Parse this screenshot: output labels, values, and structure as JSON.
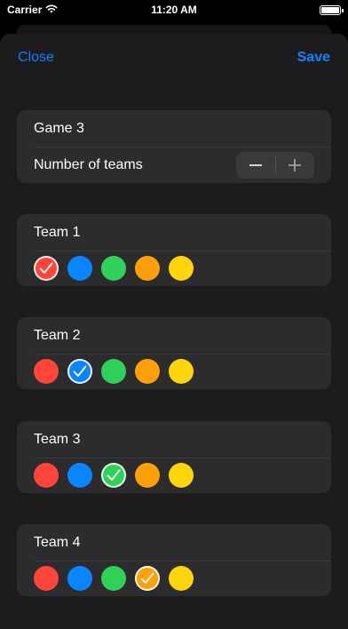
{
  "status": {
    "carrier": "Carrier",
    "time": "11:20 AM"
  },
  "nav": {
    "close_label": "Close",
    "save_label": "Save"
  },
  "game": {
    "name": "Game 3",
    "teams_label": "Number of teams"
  },
  "colors": {
    "red": "#ff453a",
    "blue": "#0a84ff",
    "green": "#30d158",
    "orange": "#ff9f0a",
    "yellow": "#ffd60a"
  },
  "teams": [
    {
      "label": "Team 1",
      "selected": "red"
    },
    {
      "label": "Team 2",
      "selected": "blue"
    },
    {
      "label": "Team 3",
      "selected": "green"
    },
    {
      "label": "Team 4",
      "selected": "orange"
    }
  ]
}
